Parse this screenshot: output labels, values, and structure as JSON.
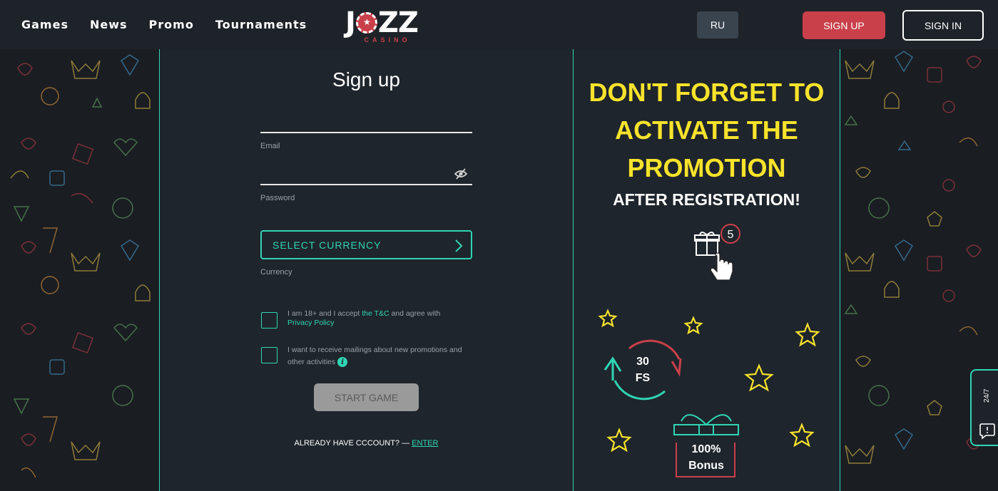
{
  "header": {
    "nav": [
      "Games",
      "News",
      "Promo",
      "Tournaments"
    ],
    "logo_main": "J  ZZ",
    "logo_sub": "CASINO",
    "lang": "RU",
    "signup_label": "SIGN UP",
    "signin_label": "SIGN IN"
  },
  "form": {
    "title": "Sign up",
    "email_label": "Email",
    "password_label": "Password",
    "currency_button": "SELECT CURRENCY",
    "currency_label": "Currency",
    "terms_prefix": "I am 18+ and I accept ",
    "terms_link": "the T&C",
    "terms_middle": " and agree with ",
    "privacy_link": "Privacy Policy",
    "mailing_text": "I want to receive mailings about new promotions and other activities",
    "start_button": "START GAME",
    "already_text": "ALREADY HAVE CCCOUNT? —",
    "enter_link": "ENTER"
  },
  "promo": {
    "title_lines": [
      "DON'T FORGET TO",
      "ACTIVATE THE",
      "PROMOTION"
    ],
    "subtitle": "AFTER REGISTRATION!",
    "gift_badge": "5",
    "fs_value": "30",
    "fs_label": "FS",
    "bonus_value": "100%",
    "bonus_label": "Bonus"
  },
  "support": {
    "label": "24/7"
  },
  "colors": {
    "accent": "#2fd5b4",
    "brand_red": "#c9404a",
    "promo_yellow": "#f7e32b"
  }
}
